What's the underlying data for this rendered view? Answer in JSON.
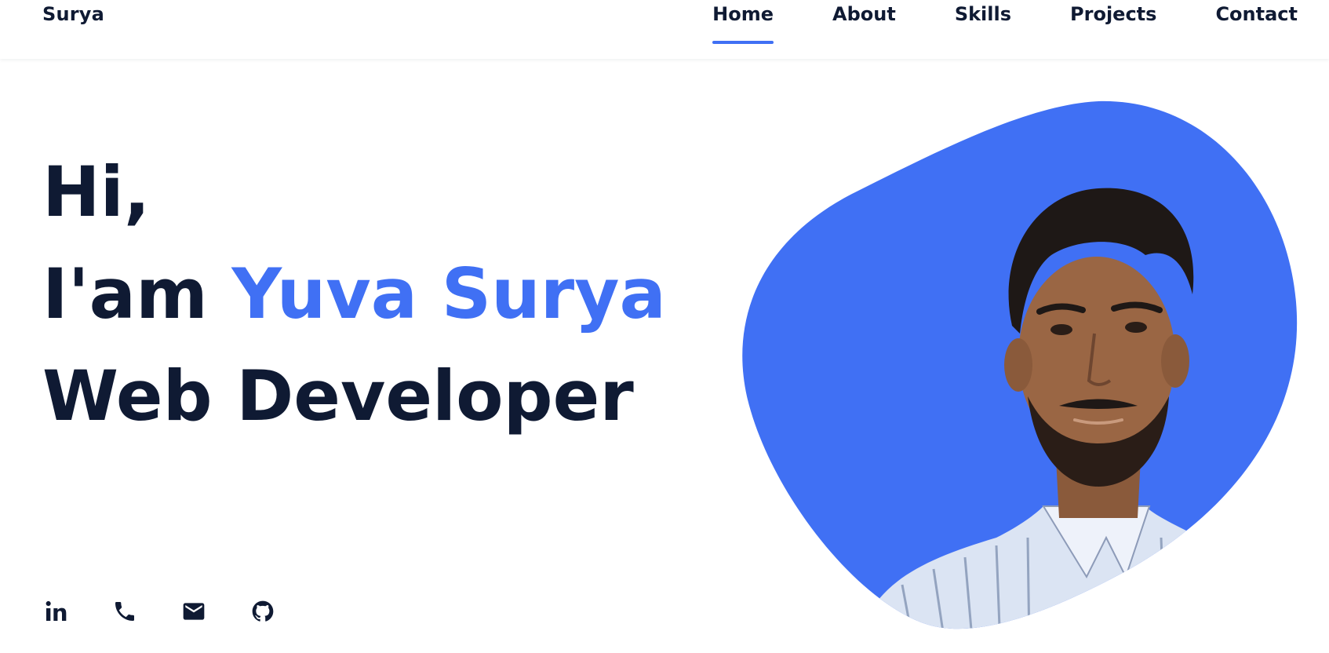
{
  "header": {
    "logo": "Surya",
    "nav": [
      {
        "label": "Home",
        "active": true
      },
      {
        "label": "About",
        "active": false
      },
      {
        "label": "Skills",
        "active": false
      },
      {
        "label": "Projects",
        "active": false
      },
      {
        "label": "Contact",
        "active": false
      }
    ]
  },
  "hero": {
    "greeting": "Hi,",
    "intro": "I'am",
    "name": "Yuva Surya",
    "role": "Web Developer"
  },
  "socials": [
    {
      "icon": "linkedin-icon"
    },
    {
      "icon": "phone-icon"
    },
    {
      "icon": "mail-icon"
    },
    {
      "icon": "github-icon"
    }
  ],
  "colors": {
    "accent": "#4070f4",
    "text": "#0f1a33",
    "background": "#ffffff"
  }
}
